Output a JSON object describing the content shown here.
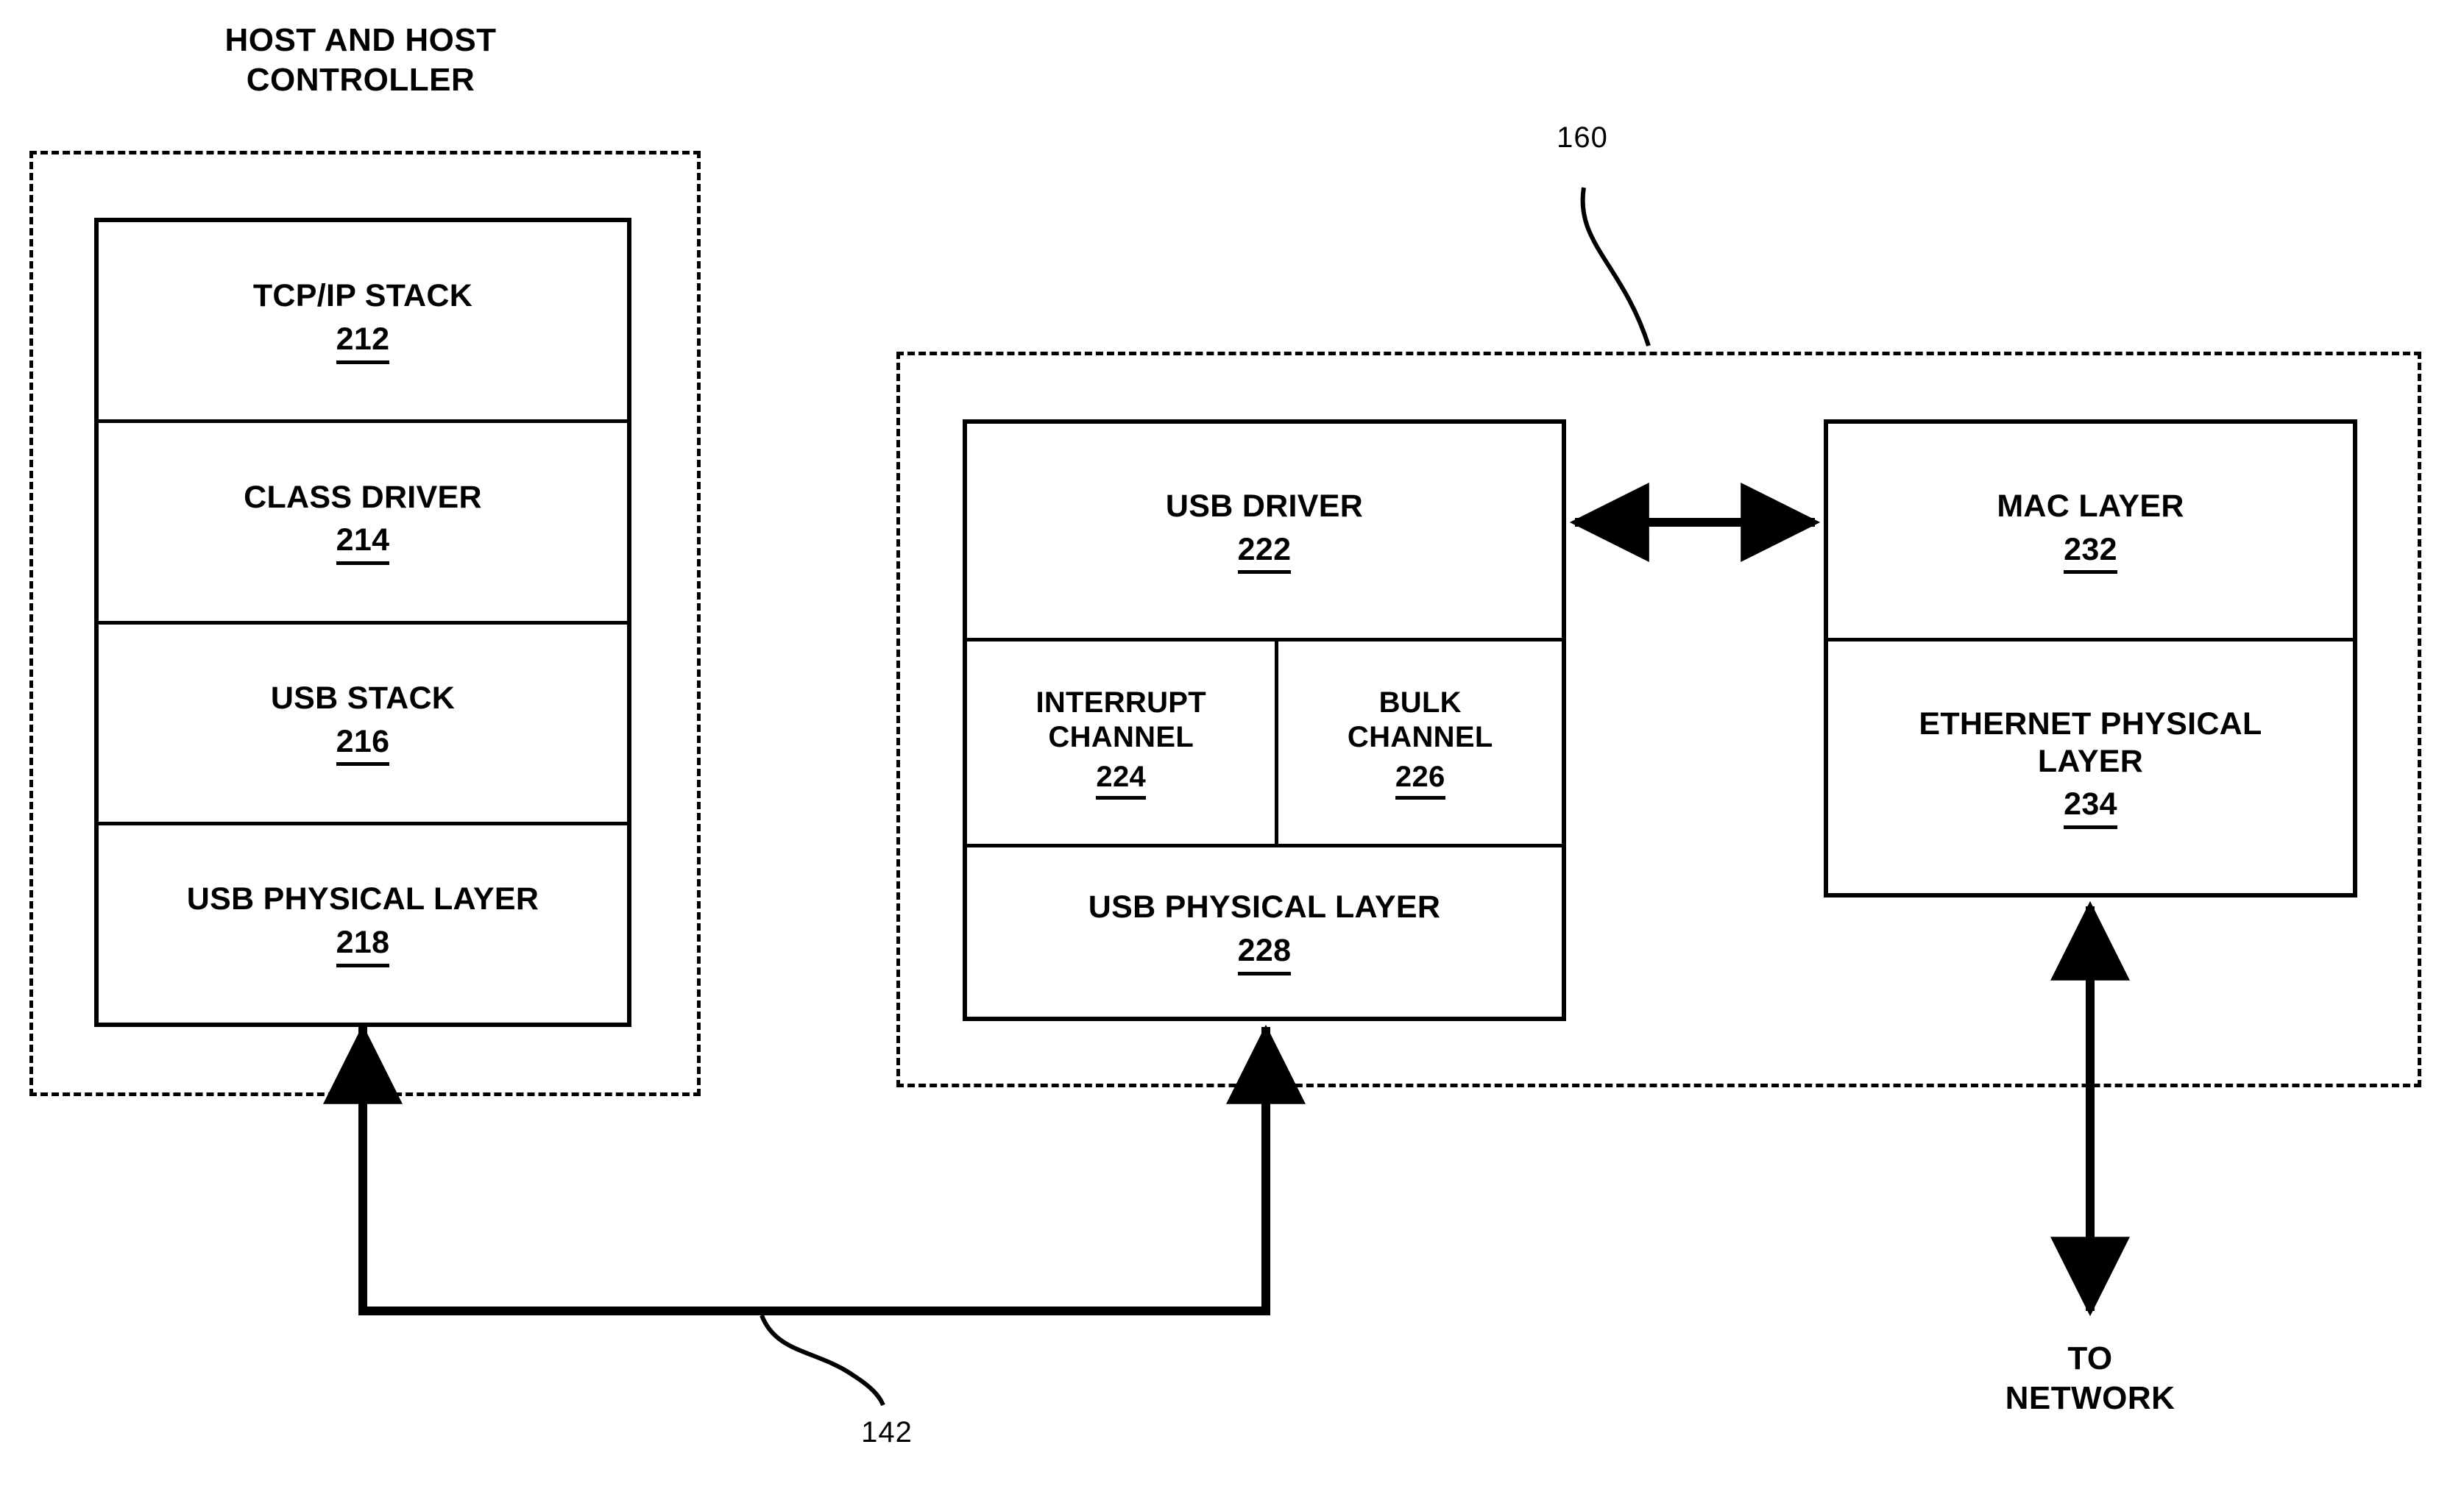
{
  "figure": {
    "host_caption": "HOST AND HOST\nCONTROLLER",
    "ref_160": "160",
    "ref_142": "142",
    "to_network": "TO\nNETWORK"
  },
  "host_enclosure": {
    "caption": "HOST AND HOST CONTROLLER",
    "modules": [
      {
        "label": "TCP/IP STACK",
        "number": "212"
      },
      {
        "label": "CLASS DRIVER",
        "number": "214"
      },
      {
        "label": "USB STACK",
        "number": "216"
      },
      {
        "label": "USB PHYSICAL LAYER",
        "number": "218"
      }
    ]
  },
  "device_enclosure": {
    "reference": "160",
    "usb_side": {
      "driver": {
        "label": "USB DRIVER",
        "number": "222"
      },
      "channels": [
        {
          "label": "INTERRUPT\nCHANNEL",
          "number": "224"
        },
        {
          "label": "BULK\nCHANNEL",
          "number": "226"
        }
      ],
      "physical": {
        "label": "USB PHYSICAL LAYER",
        "number": "228"
      }
    },
    "network_side": {
      "modules": [
        {
          "label": "MAC LAYER",
          "number": "232"
        },
        {
          "label": "ETHERNET PHYSICAL\nLAYER",
          "number": "234"
        }
      ]
    }
  },
  "connectors": {
    "usb_cable_reference": "142",
    "network_label": "TO\nNETWORK",
    "stroke_color": "#000000"
  }
}
